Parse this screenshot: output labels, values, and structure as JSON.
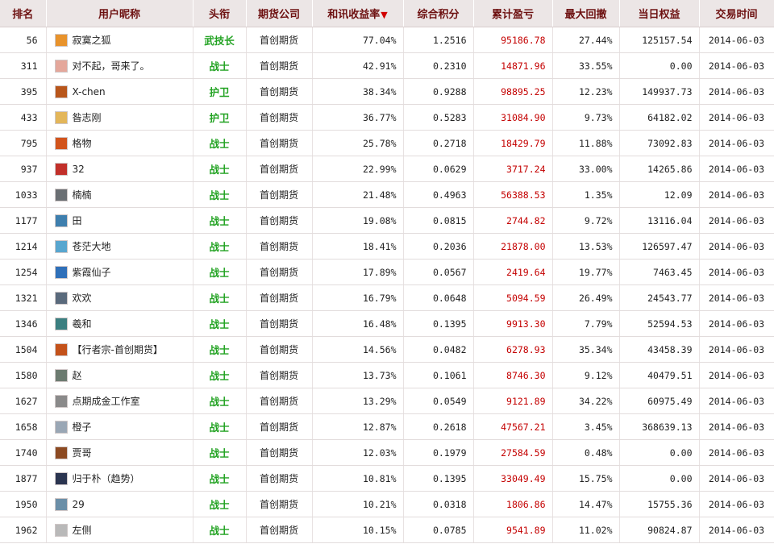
{
  "columns": {
    "rank": "排名",
    "nickname": "用户昵称",
    "title": "头衔",
    "company": "期货公司",
    "return_rate": "和讯收益率",
    "score": "综合积分",
    "total_pnl": "累计盈亏",
    "max_drawdown": "最大回撤",
    "equity": "当日权益",
    "trade_time": "交易时间"
  },
  "sort_indicator": "▼",
  "rows": [
    {
      "rank": "56",
      "nickname": "寂寞之狐",
      "title": "武技长",
      "company": "首创期货",
      "return_rate": "77.04%",
      "score": "1.2516",
      "total_pnl": "95186.78",
      "max_drawdown": "27.44%",
      "equity": "125157.54",
      "trade_time": "2014-06-03",
      "avatar_color": "#e8932c"
    },
    {
      "rank": "311",
      "nickname": "对不起，哥来了。",
      "title": "战士",
      "company": "首创期货",
      "return_rate": "42.91%",
      "score": "0.2310",
      "total_pnl": "14871.96",
      "max_drawdown": "33.55%",
      "equity": "0.00",
      "trade_time": "2014-06-03",
      "avatar_color": "#e4a79b"
    },
    {
      "rank": "395",
      "nickname": "X-chen",
      "title": "护卫",
      "company": "首创期货",
      "return_rate": "38.34%",
      "score": "0.9288",
      "total_pnl": "98895.25",
      "max_drawdown": "12.23%",
      "equity": "149937.73",
      "trade_time": "2014-06-03",
      "avatar_color": "#b8561b"
    },
    {
      "rank": "433",
      "nickname": "昝志刚",
      "title": "护卫",
      "company": "首创期货",
      "return_rate": "36.77%",
      "score": "0.5283",
      "total_pnl": "31084.90",
      "max_drawdown": "9.73%",
      "equity": "64182.02",
      "trade_time": "2014-06-03",
      "avatar_color": "#e3b65a"
    },
    {
      "rank": "795",
      "nickname": "格物",
      "title": "战士",
      "company": "首创期货",
      "return_rate": "25.78%",
      "score": "0.2718",
      "total_pnl": "18429.79",
      "max_drawdown": "11.88%",
      "equity": "73092.83",
      "trade_time": "2014-06-03",
      "avatar_color": "#d2541c"
    },
    {
      "rank": "937",
      "nickname": "32",
      "title": "战士",
      "company": "首创期货",
      "return_rate": "22.99%",
      "score": "0.0629",
      "total_pnl": "3717.24",
      "max_drawdown": "33.00%",
      "equity": "14265.86",
      "trade_time": "2014-06-03",
      "avatar_color": "#c2302a"
    },
    {
      "rank": "1033",
      "nickname": "楠楠",
      "title": "战士",
      "company": "首创期货",
      "return_rate": "21.48%",
      "score": "0.4963",
      "total_pnl": "56388.53",
      "max_drawdown": "1.35%",
      "equity": "12.09",
      "trade_time": "2014-06-03",
      "avatar_color": "#6a6f73"
    },
    {
      "rank": "1177",
      "nickname": "田",
      "title": "战士",
      "company": "首创期货",
      "return_rate": "19.08%",
      "score": "0.0815",
      "total_pnl": "2744.82",
      "max_drawdown": "9.72%",
      "equity": "13116.04",
      "trade_time": "2014-06-03",
      "avatar_color": "#3e7fae"
    },
    {
      "rank": "1214",
      "nickname": "苍茫大地",
      "title": "战士",
      "company": "首创期货",
      "return_rate": "18.41%",
      "score": "0.2036",
      "total_pnl": "21878.00",
      "max_drawdown": "13.53%",
      "equity": "126597.47",
      "trade_time": "2014-06-03",
      "avatar_color": "#58a6cf"
    },
    {
      "rank": "1254",
      "nickname": "紫霞仙子",
      "title": "战士",
      "company": "首创期货",
      "return_rate": "17.89%",
      "score": "0.0567",
      "total_pnl": "2419.64",
      "max_drawdown": "19.77%",
      "equity": "7463.45",
      "trade_time": "2014-06-03",
      "avatar_color": "#2f70b9"
    },
    {
      "rank": "1321",
      "nickname": "欢欢",
      "title": "战士",
      "company": "首创期货",
      "return_rate": "16.79%",
      "score": "0.0648",
      "total_pnl": "5094.59",
      "max_drawdown": "26.49%",
      "equity": "24543.77",
      "trade_time": "2014-06-03",
      "avatar_color": "#5a6a7c"
    },
    {
      "rank": "1346",
      "nickname": "羲和",
      "title": "战士",
      "company": "首创期货",
      "return_rate": "16.48%",
      "score": "0.1395",
      "total_pnl": "9913.30",
      "max_drawdown": "7.79%",
      "equity": "52594.53",
      "trade_time": "2014-06-03",
      "avatar_color": "#3b7f80"
    },
    {
      "rank": "1504",
      "nickname": "【行者宗-首创期货】",
      "title": "战士",
      "company": "首创期货",
      "return_rate": "14.56%",
      "score": "0.0482",
      "total_pnl": "6278.93",
      "max_drawdown": "35.34%",
      "equity": "43458.39",
      "trade_time": "2014-06-03",
      "avatar_color": "#c4521a"
    },
    {
      "rank": "1580",
      "nickname": "赵",
      "title": "战士",
      "company": "首创期货",
      "return_rate": "13.73%",
      "score": "0.1061",
      "total_pnl": "8746.30",
      "max_drawdown": "9.12%",
      "equity": "40479.51",
      "trade_time": "2014-06-03",
      "avatar_color": "#6c7b70"
    },
    {
      "rank": "1627",
      "nickname": "点期成金工作室",
      "title": "战士",
      "company": "首创期货",
      "return_rate": "13.29%",
      "score": "0.0549",
      "total_pnl": "9121.89",
      "max_drawdown": "34.22%",
      "equity": "60975.49",
      "trade_time": "2014-06-03",
      "avatar_color": "#8a8a8a"
    },
    {
      "rank": "1658",
      "nickname": "橙子",
      "title": "战士",
      "company": "首创期货",
      "return_rate": "12.87%",
      "score": "0.2618",
      "total_pnl": "47567.21",
      "max_drawdown": "3.45%",
      "equity": "368639.13",
      "trade_time": "2014-06-03",
      "avatar_color": "#9aa7b5"
    },
    {
      "rank": "1740",
      "nickname": "贾哥",
      "title": "战士",
      "company": "首创期货",
      "return_rate": "12.03%",
      "score": "0.1979",
      "total_pnl": "27584.59",
      "max_drawdown": "0.48%",
      "equity": "0.00",
      "trade_time": "2014-06-03",
      "avatar_color": "#8c4a22"
    },
    {
      "rank": "1877",
      "nickname": "归于朴（趋势）",
      "title": "战士",
      "company": "首创期货",
      "return_rate": "10.81%",
      "score": "0.1395",
      "total_pnl": "33049.49",
      "max_drawdown": "15.75%",
      "equity": "0.00",
      "trade_time": "2014-06-03",
      "avatar_color": "#2b3550"
    },
    {
      "rank": "1950",
      "nickname": "29",
      "title": "战士",
      "company": "首创期货",
      "return_rate": "10.21%",
      "score": "0.0318",
      "total_pnl": "1806.86",
      "max_drawdown": "14.47%",
      "equity": "15755.36",
      "trade_time": "2014-06-03",
      "avatar_color": "#6b8fa8"
    },
    {
      "rank": "1962",
      "nickname": "左侧",
      "title": "战士",
      "company": "首创期货",
      "return_rate": "10.15%",
      "score": "0.0785",
      "total_pnl": "9541.89",
      "max_drawdown": "11.02%",
      "equity": "90824.87",
      "trade_time": "2014-06-03",
      "avatar_color": "#b9b9b9"
    }
  ]
}
